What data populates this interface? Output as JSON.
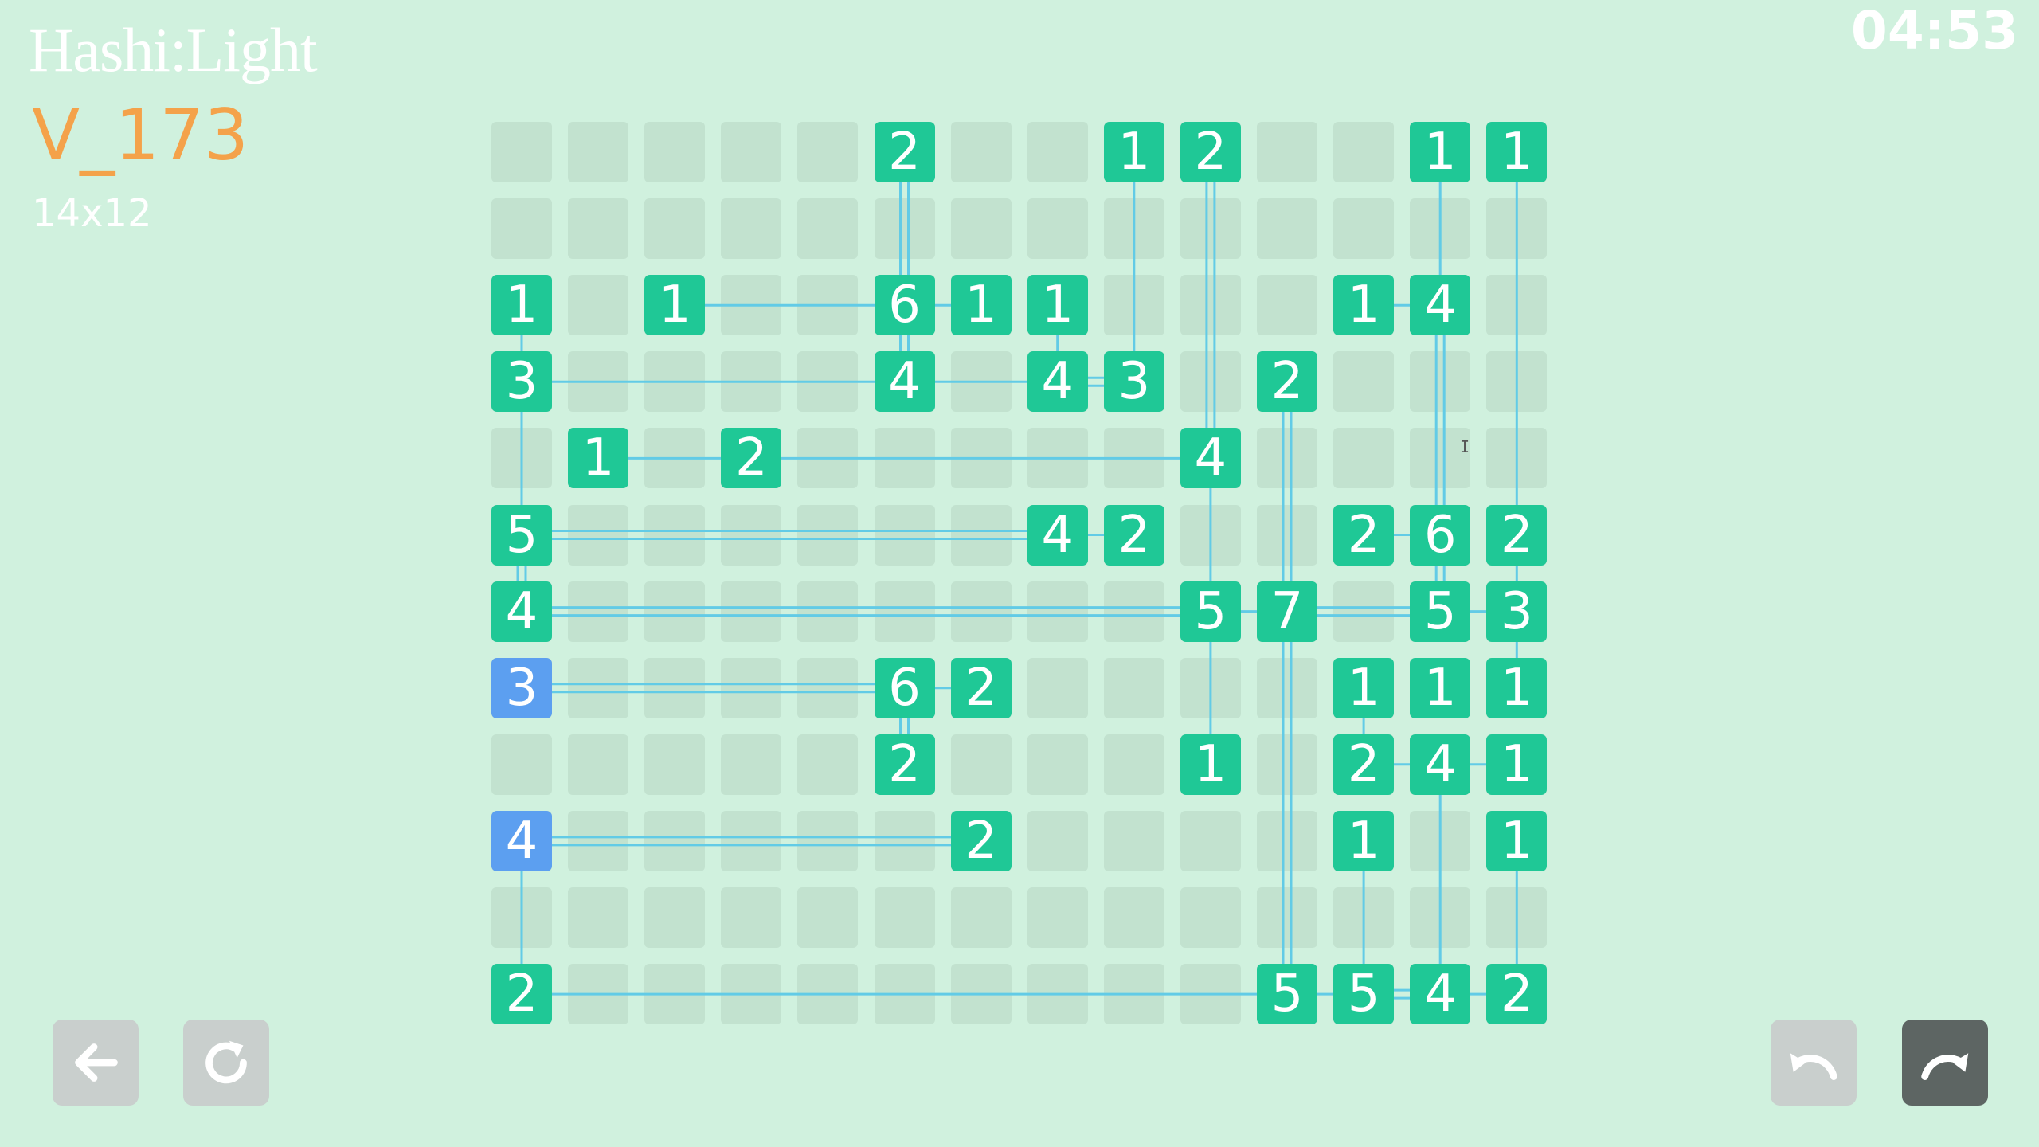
{
  "app_title": "Hashi:Light",
  "level": {
    "name": "V_173",
    "size": "14x12"
  },
  "timer": "04:53",
  "grid": {
    "cols": 14,
    "rows": 12
  },
  "selected_islands": [
    [
      0,
      7
    ],
    [
      0,
      9
    ]
  ],
  "islands": [
    [
      5,
      0,
      2
    ],
    [
      8,
      0,
      1
    ],
    [
      9,
      0,
      2
    ],
    [
      12,
      0,
      1
    ],
    [
      13,
      0,
      1
    ],
    [
      0,
      2,
      1
    ],
    [
      2,
      2,
      1
    ],
    [
      5,
      2,
      6
    ],
    [
      6,
      2,
      1
    ],
    [
      7,
      2,
      1
    ],
    [
      11,
      2,
      1
    ],
    [
      12,
      2,
      4
    ],
    [
      0,
      3,
      3
    ],
    [
      5,
      3,
      4
    ],
    [
      7,
      3,
      4
    ],
    [
      8,
      3,
      3
    ],
    [
      10,
      3,
      2
    ],
    [
      1,
      4,
      1
    ],
    [
      3,
      4,
      2
    ],
    [
      9,
      4,
      4
    ],
    [
      0,
      5,
      5
    ],
    [
      7,
      5,
      4
    ],
    [
      8,
      5,
      2
    ],
    [
      11,
      5,
      2
    ],
    [
      12,
      5,
      6
    ],
    [
      13,
      5,
      2
    ],
    [
      0,
      6,
      4
    ],
    [
      9,
      6,
      5
    ],
    [
      10,
      6,
      7
    ],
    [
      12,
      6,
      5
    ],
    [
      13,
      6,
      3
    ],
    [
      0,
      7,
      3
    ],
    [
      5,
      7,
      6
    ],
    [
      6,
      7,
      2
    ],
    [
      11,
      7,
      1
    ],
    [
      12,
      7,
      1
    ],
    [
      13,
      7,
      1
    ],
    [
      5,
      8,
      2
    ],
    [
      9,
      8,
      1
    ],
    [
      11,
      8,
      2
    ],
    [
      12,
      8,
      4
    ],
    [
      13,
      8,
      1
    ],
    [
      0,
      9,
      4
    ],
    [
      6,
      9,
      2
    ],
    [
      11,
      9,
      1
    ],
    [
      13,
      9,
      1
    ],
    [
      0,
      11,
      2
    ],
    [
      10,
      11,
      5
    ],
    [
      11,
      11,
      5
    ],
    [
      12,
      11,
      4
    ],
    [
      13,
      11,
      2
    ]
  ],
  "bridges": [
    [
      [
        5,
        0
      ],
      [
        5,
        2
      ],
      2
    ],
    [
      [
        8,
        0
      ],
      [
        8,
        3
      ],
      1
    ],
    [
      [
        9,
        0
      ],
      [
        9,
        4
      ],
      2
    ],
    [
      [
        12,
        0
      ],
      [
        12,
        2
      ],
      1
    ],
    [
      [
        13,
        0
      ],
      [
        13,
        5
      ],
      1
    ],
    [
      [
        0,
        2
      ],
      [
        0,
        3
      ],
      1
    ],
    [
      [
        2,
        2
      ],
      [
        5,
        2
      ],
      1
    ],
    [
      [
        5,
        2
      ],
      [
        6,
        2
      ],
      1
    ],
    [
      [
        5,
        2
      ],
      [
        5,
        3
      ],
      2
    ],
    [
      [
        7,
        2
      ],
      [
        7,
        3
      ],
      1
    ],
    [
      [
        11,
        2
      ],
      [
        12,
        2
      ],
      1
    ],
    [
      [
        12,
        2
      ],
      [
        12,
        5
      ],
      2
    ],
    [
      [
        0,
        3
      ],
      [
        5,
        3
      ],
      1
    ],
    [
      [
        5,
        3
      ],
      [
        7,
        3
      ],
      1
    ],
    [
      [
        7,
        3
      ],
      [
        8,
        3
      ],
      2
    ],
    [
      [
        0,
        3
      ],
      [
        0,
        5
      ],
      1
    ],
    [
      [
        10,
        3
      ],
      [
        10,
        6
      ],
      2
    ],
    [
      [
        1,
        4
      ],
      [
        3,
        4
      ],
      1
    ],
    [
      [
        3,
        4
      ],
      [
        9,
        4
      ],
      1
    ],
    [
      [
        9,
        4
      ],
      [
        9,
        6
      ],
      1
    ],
    [
      [
        0,
        5
      ],
      [
        7,
        5
      ],
      2
    ],
    [
      [
        7,
        5
      ],
      [
        8,
        5
      ],
      1
    ],
    [
      [
        11,
        5
      ],
      [
        12,
        5
      ],
      1
    ],
    [
      [
        12,
        5
      ],
      [
        12,
        6
      ],
      2
    ],
    [
      [
        13,
        5
      ],
      [
        13,
        6
      ],
      1
    ],
    [
      [
        0,
        5
      ],
      [
        0,
        6
      ],
      2
    ],
    [
      [
        0,
        6
      ],
      [
        9,
        6
      ],
      2
    ],
    [
      [
        9,
        6
      ],
      [
        10,
        6
      ],
      1
    ],
    [
      [
        10,
        6
      ],
      [
        12,
        6
      ],
      2
    ],
    [
      [
        12,
        6
      ],
      [
        13,
        6
      ],
      1
    ],
    [
      [
        10,
        6
      ],
      [
        10,
        11
      ],
      2
    ],
    [
      [
        13,
        6
      ],
      [
        13,
        7
      ],
      1
    ],
    [
      [
        9,
        6
      ],
      [
        9,
        8
      ],
      1
    ],
    [
      [
        0,
        7
      ],
      [
        5,
        7
      ],
      2
    ],
    [
      [
        5,
        7
      ],
      [
        6,
        7
      ],
      1
    ],
    [
      [
        5,
        7
      ],
      [
        5,
        8
      ],
      2
    ],
    [
      [
        11,
        7
      ],
      [
        11,
        8
      ],
      1
    ],
    [
      [
        11,
        8
      ],
      [
        12,
        8
      ],
      1
    ],
    [
      [
        12,
        8
      ],
      [
        13,
        8
      ],
      1
    ],
    [
      [
        12,
        8
      ],
      [
        12,
        11
      ],
      1
    ],
    [
      [
        0,
        9
      ],
      [
        6,
        9
      ],
      2
    ],
    [
      [
        0,
        9
      ],
      [
        0,
        11
      ],
      1
    ],
    [
      [
        11,
        9
      ],
      [
        11,
        11
      ],
      1
    ],
    [
      [
        13,
        9
      ],
      [
        13,
        11
      ],
      1
    ],
    [
      [
        0,
        11
      ],
      [
        10,
        11
      ],
      1
    ],
    [
      [
        10,
        11
      ],
      [
        11,
        11
      ],
      1
    ],
    [
      [
        11,
        11
      ],
      [
        12,
        11
      ],
      2
    ],
    [
      [
        12,
        11
      ],
      [
        13,
        11
      ],
      1
    ]
  ],
  "buttons": {
    "back": "back-arrow-icon",
    "restart": "restart-icon",
    "undo": "undo-icon",
    "redo": "redo-icon"
  },
  "colors": {
    "background": "#d0f1de",
    "empty_cell": "#c2e2cf",
    "island": "#1fc896",
    "island_selected": "#5c9ff0",
    "bridge": "#62cbe6",
    "title_level": "#f4a24a"
  }
}
